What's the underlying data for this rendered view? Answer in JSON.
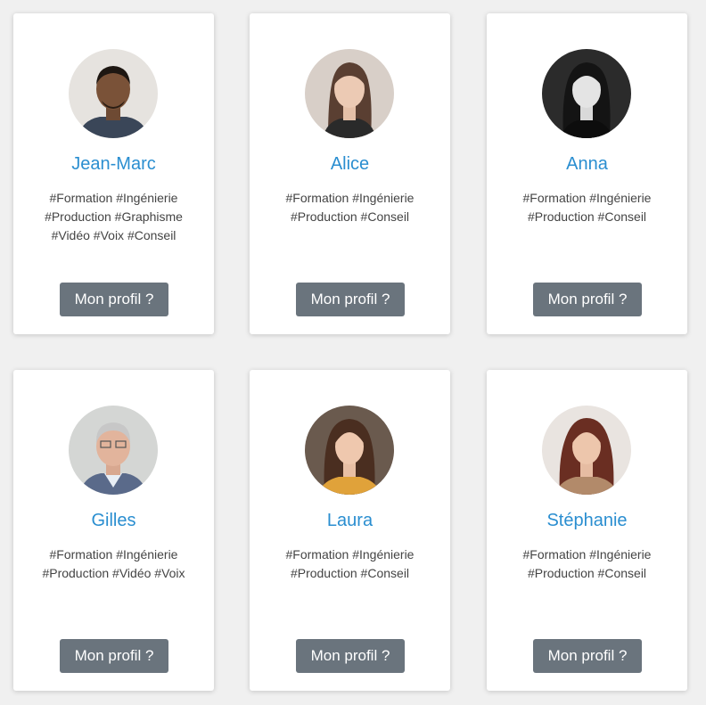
{
  "profiles": [
    {
      "name": "Jean-Marc",
      "tags": [
        "#Formation #Ingénierie",
        "#Production #Graphisme",
        "#Vidéo #Voix #Conseil"
      ],
      "button": "Mon profil ?"
    },
    {
      "name": "Alice",
      "tags": [
        "#Formation #Ingénierie",
        "#Production #Conseil"
      ],
      "button": "Mon profil ?"
    },
    {
      "name": "Anna",
      "tags": [
        "#Formation #Ingénierie",
        "#Production #Conseil"
      ],
      "button": "Mon profil ?"
    },
    {
      "name": "Gilles",
      "tags": [
        "#Formation #Ingénierie",
        "#Production #Vidéo #Voix"
      ],
      "button": "Mon profil ?"
    },
    {
      "name": "Laura",
      "tags": [
        "#Formation #Ingénierie",
        "#Production #Conseil"
      ],
      "button": "Mon profil ?"
    },
    {
      "name": "Stéphanie",
      "tags": [
        "#Formation #Ingénierie",
        "#Production #Conseil"
      ],
      "button": "Mon profil ?"
    }
  ],
  "colors": {
    "name": "#2a8ed0",
    "button": "#6a747d",
    "background": "#f0f0f0"
  }
}
